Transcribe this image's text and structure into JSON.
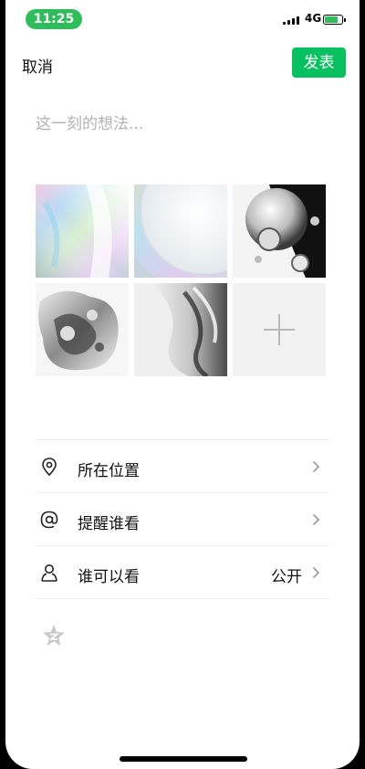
{
  "status_bar": {
    "time": "11:25",
    "network": "4G"
  },
  "header": {
    "cancel_label": "取消",
    "publish_label": "发表"
  },
  "composer": {
    "placeholder": "这一刻的想法..."
  },
  "options": {
    "location_label": "所在位置",
    "remind_label": "提醒谁看",
    "visibility_label": "谁可以看",
    "visibility_value": "公开"
  },
  "icons": {
    "location": "location-pin-icon",
    "remind": "at-sign-icon",
    "visibility": "person-icon",
    "qzone": "qzone-star-icon"
  },
  "colors": {
    "accent": "#07c160",
    "status_pill": "#2fbd5c"
  }
}
